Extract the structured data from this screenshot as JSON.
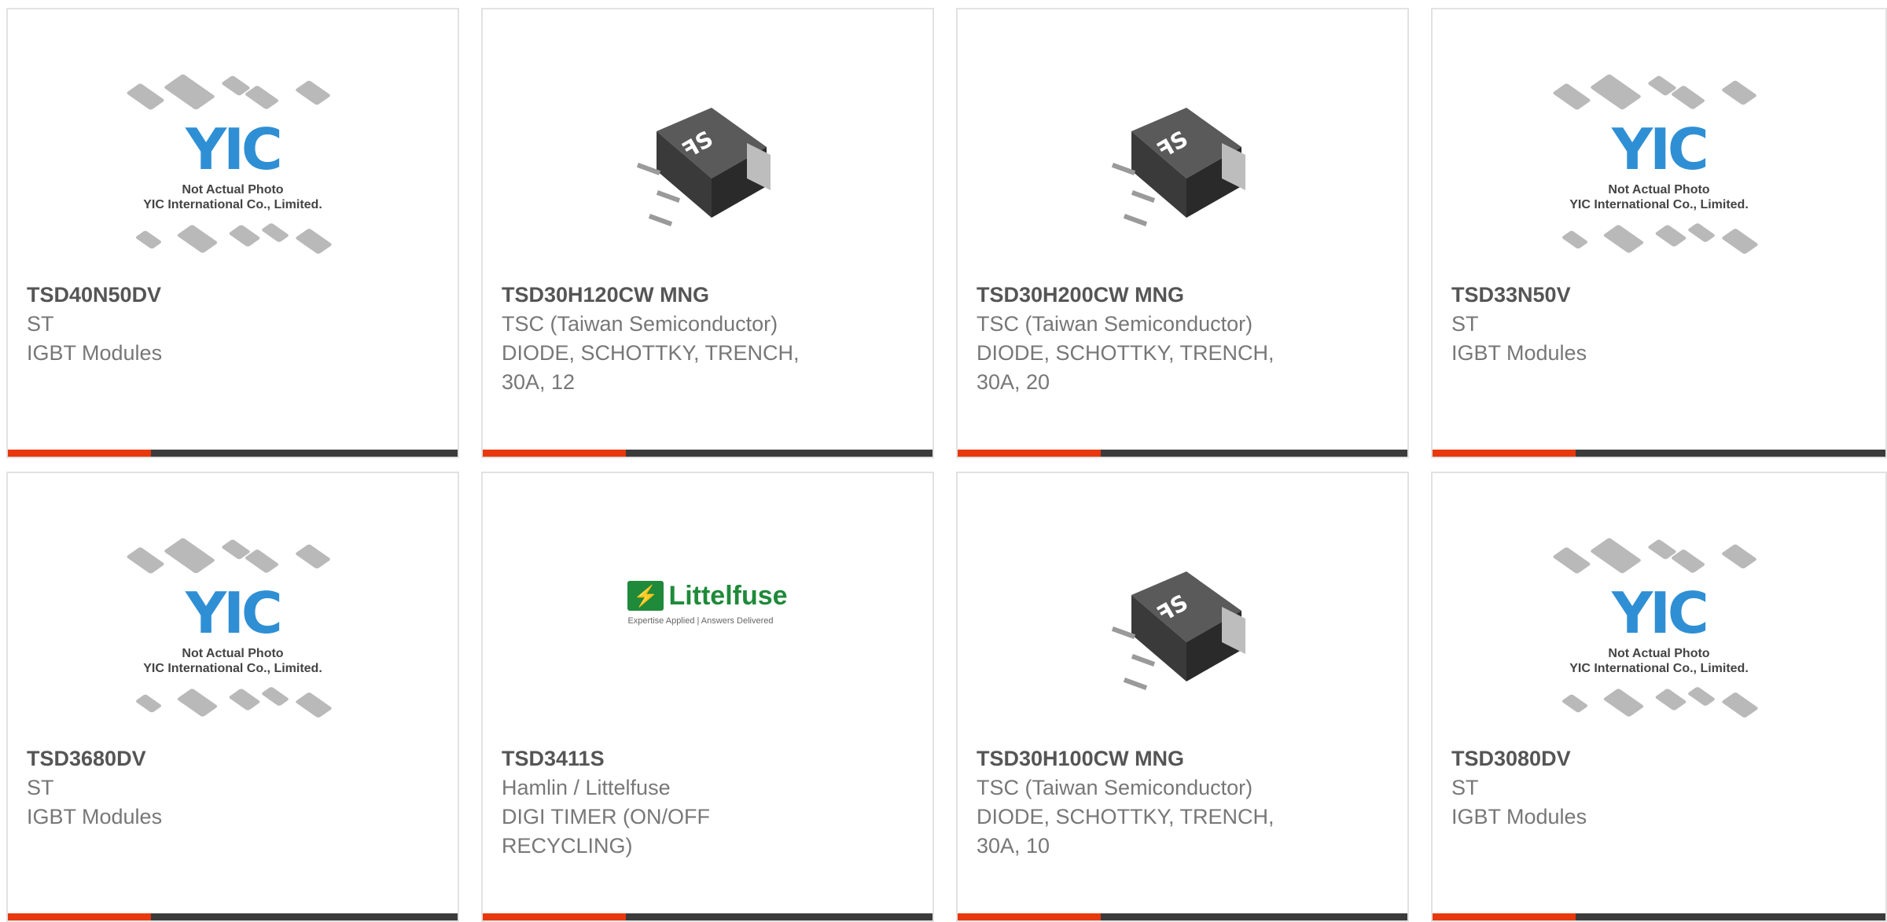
{
  "cards": [
    {
      "part": "TSD40N50DV",
      "manufacturer": "ST",
      "desc_line1": "IGBT Modules",
      "desc_line2": "",
      "image": "placeholder"
    },
    {
      "part": "TSD30H120CW MNG",
      "manufacturer": "TSC (Taiwan Semiconductor)",
      "desc_line1": "DIODE, SCHOTTKY, TRENCH,",
      "desc_line2": "30A, 12",
      "image": "package"
    },
    {
      "part": "TSD30H200CW MNG",
      "manufacturer": "TSC (Taiwan Semiconductor)",
      "desc_line1": "DIODE, SCHOTTKY, TRENCH,",
      "desc_line2": "30A, 20",
      "image": "package"
    },
    {
      "part": "TSD33N50V",
      "manufacturer": "ST",
      "desc_line1": "IGBT Modules",
      "desc_line2": "",
      "image": "placeholder"
    },
    {
      "part": "TSD3680DV",
      "manufacturer": "ST",
      "desc_line1": "IGBT Modules",
      "desc_line2": "",
      "image": "placeholder"
    },
    {
      "part": "TSD3411S",
      "manufacturer": "Hamlin / Littelfuse",
      "desc_line1": "DIGI TIMER (ON/OFF",
      "desc_line2": "RECYCLING)",
      "image": "littelfuse"
    },
    {
      "part": "TSD30H100CW MNG",
      "manufacturer": "TSC (Taiwan Semiconductor)",
      "desc_line1": "DIODE, SCHOTTKY, TRENCH,",
      "desc_line2": "30A, 10",
      "image": "package"
    },
    {
      "part": "TSD3080DV",
      "manufacturer": "ST",
      "desc_line1": "IGBT Modules",
      "desc_line2": "",
      "image": "placeholder"
    }
  ],
  "placeholder": {
    "logo_text": "YIC",
    "note_line1": "Not Actual Photo",
    "note_line2": "YIC International Co., Limited."
  },
  "littelfuse": {
    "name": "Littelfuse",
    "tagline": "Expertise Applied | Answers Delivered"
  },
  "colors": {
    "accent": "#e8380d",
    "bar": "#3b3b3b",
    "border": "#e2e2e2",
    "text_part": "#555555",
    "text_meta": "#777777",
    "brand_green": "#1f8a3a",
    "yic_blue": "#2f8fd4"
  }
}
